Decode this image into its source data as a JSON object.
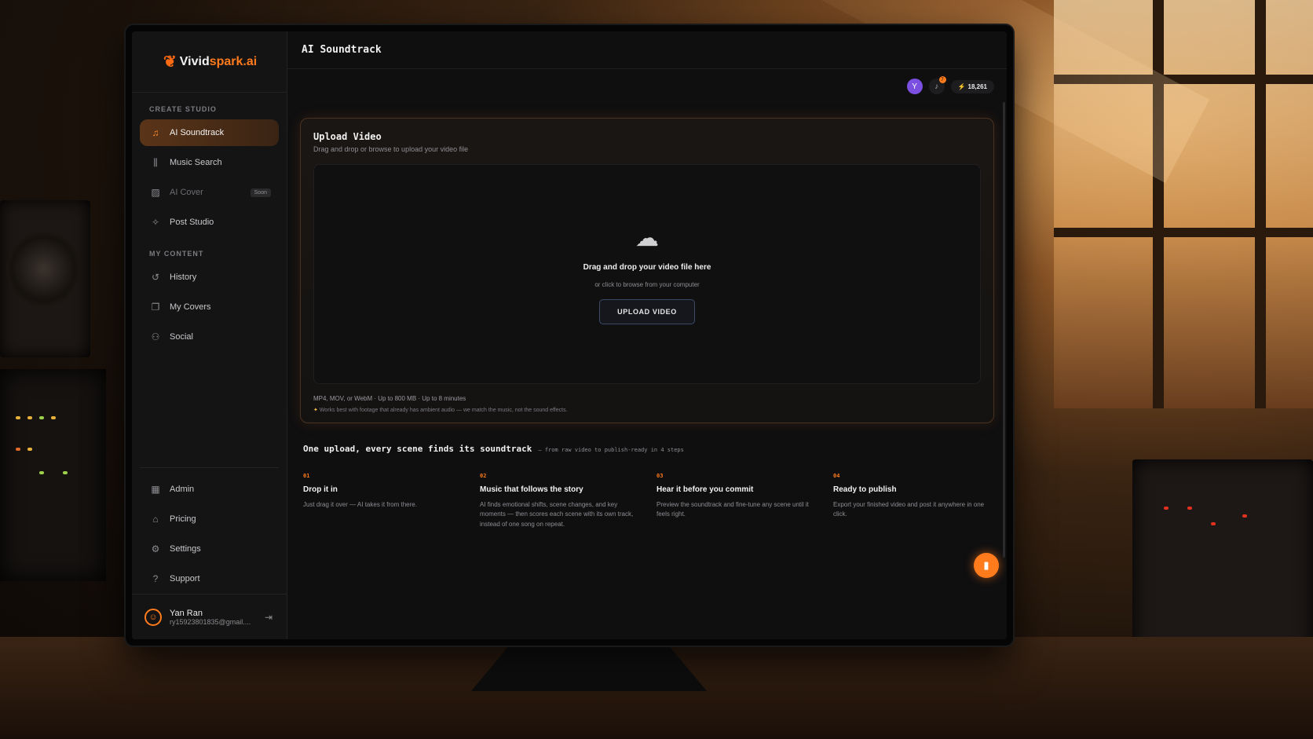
{
  "brand": {
    "logo_part1": "Vivid",
    "logo_part2": "spark.ai"
  },
  "header": {
    "page_title": "AI Soundtrack"
  },
  "sidebar": {
    "section_create": "CREATE STUDIO",
    "create_items": [
      {
        "label": "AI Soundtrack",
        "icon": "music-note-icon"
      },
      {
        "label": "Music Search",
        "icon": "library-icon"
      },
      {
        "label": "AI Cover",
        "icon": "image-icon",
        "badge": "Soon"
      },
      {
        "label": "Post Studio",
        "icon": "sparkle-icon"
      }
    ],
    "section_content": "MY CONTENT",
    "content_items": [
      {
        "label": "History",
        "icon": "history-icon"
      },
      {
        "label": "My Covers",
        "icon": "covers-icon"
      },
      {
        "label": "Social",
        "icon": "users-icon"
      }
    ],
    "bottom_items": [
      {
        "label": "Admin",
        "icon": "grid-icon"
      },
      {
        "label": "Pricing",
        "icon": "tag-icon"
      },
      {
        "label": "Settings",
        "icon": "gear-icon"
      },
      {
        "label": "Support",
        "icon": "help-icon"
      }
    ],
    "user": {
      "name": "Yan Ran",
      "email": "ry15923801835@gmail...."
    }
  },
  "topbar": {
    "avatar_letter": "Y",
    "notification_count": "7",
    "credits": "18,261"
  },
  "upload": {
    "title": "Upload Video",
    "subtitle": "Drag and drop or browse to upload your video file",
    "drop_title": "Drag and drop your video file here",
    "drop_sub": "or click to browse from your computer",
    "button_label": "UPLOAD VIDEO",
    "formats": "MP4, MOV, or WebM · Up to 800 MB · Up to 8 minutes",
    "tip": "Works best with footage that already has ambient audio — we match the music, not the sound effects."
  },
  "steps_section": {
    "title": "One upload, every scene finds its soundtrack",
    "subtitle": "— from raw video to publish-ready in 4 steps",
    "steps": [
      {
        "num": "01",
        "title": "Drop it in",
        "desc": "Just drag it over — AI takes it from there."
      },
      {
        "num": "02",
        "title": "Music that follows the story",
        "desc": "AI finds emotional shifts, scene changes, and key moments — then scores each scene with its own track, instead of one song on repeat."
      },
      {
        "num": "03",
        "title": "Hear it before you commit",
        "desc": "Preview the soundtrack and fine-tune any scene until it feels right."
      },
      {
        "num": "04",
        "title": "Ready to publish",
        "desc": "Export your finished video and post it anywhere in one click."
      }
    ]
  },
  "colors": {
    "accent": "#ff7b1c",
    "background": "#0f0f10",
    "sidebar": "#141415"
  }
}
